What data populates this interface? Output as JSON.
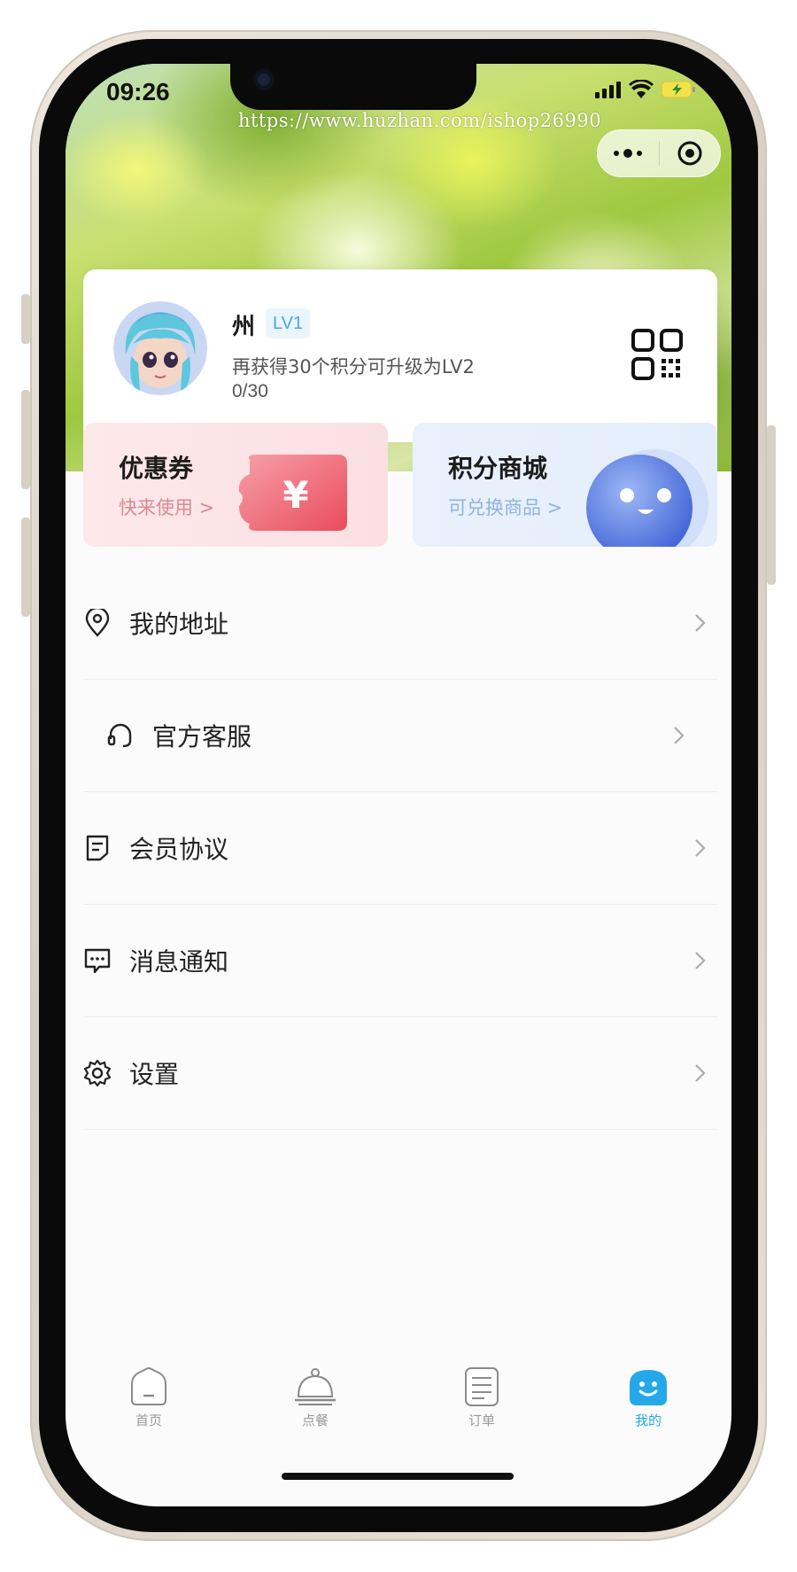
{
  "watermark": "https://www.huzhan.com/ishop26990",
  "status_bar": {
    "time": "09:26"
  },
  "profile": {
    "name": "州",
    "level": "LV1",
    "upgrade_hint": "再获得30个积分可升级为LV2",
    "points_progress": "0/30"
  },
  "promos": {
    "coupon": {
      "title": "优惠券",
      "subtitle": "快来使用 >",
      "symbol": "¥"
    },
    "mall": {
      "title": "积分商城",
      "subtitle": "可兑换商品 >"
    }
  },
  "menu": [
    {
      "label": "我的地址",
      "icon": "location-pin-icon"
    },
    {
      "label": "官方客服",
      "icon": "headset-icon"
    },
    {
      "label": "会员协议",
      "icon": "document-icon"
    },
    {
      "label": "消息通知",
      "icon": "message-icon"
    },
    {
      "label": "设置",
      "icon": "gear-icon"
    }
  ],
  "tabbar": {
    "items": [
      {
        "label": "首页",
        "icon": "home-icon"
      },
      {
        "label": "点餐",
        "icon": "food-cloche-icon"
      },
      {
        "label": "订单",
        "icon": "order-list-icon"
      },
      {
        "label": "我的",
        "icon": "smiley-icon"
      }
    ],
    "active_index": 3
  },
  "colors": {
    "accent": "#25a8ea",
    "level_badge_bg": "#eaf5fd",
    "level_badge_text": "#4aa9e6",
    "coupon_bg": "#fde8ea",
    "mall_bg": "#eaf1fd"
  }
}
